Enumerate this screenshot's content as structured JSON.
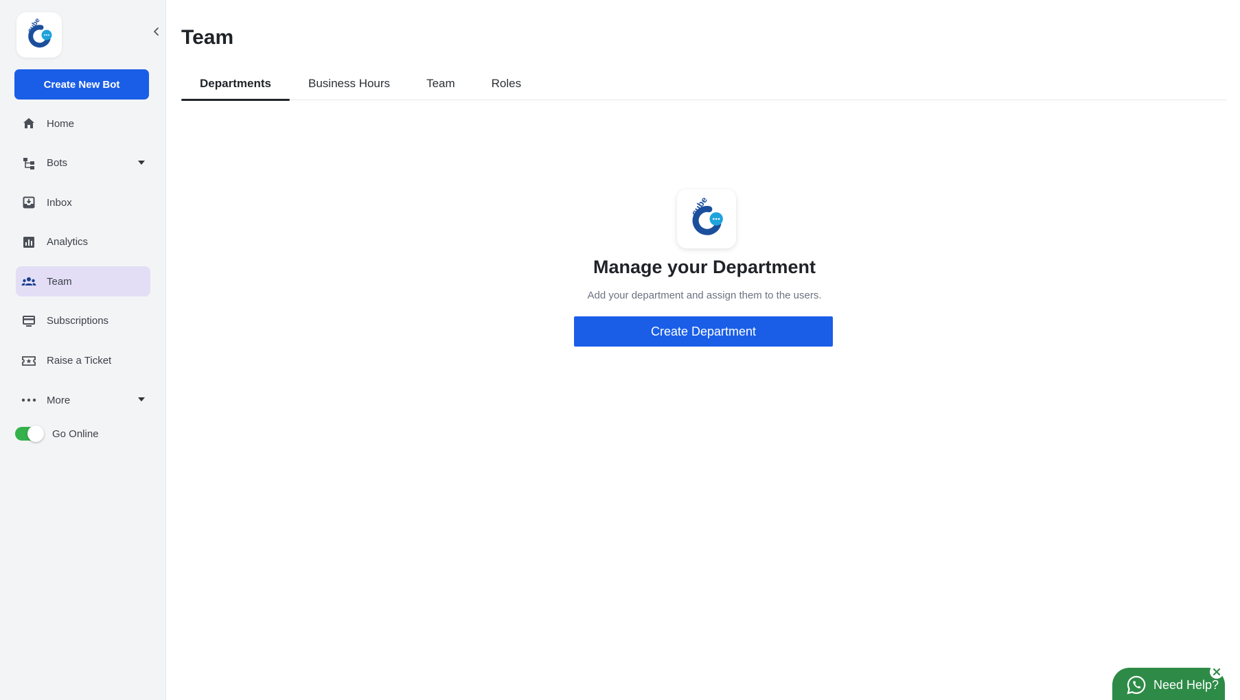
{
  "sidebar": {
    "create_button": "Create New Bot",
    "items": [
      {
        "label": "Home",
        "icon": "home-icon"
      },
      {
        "label": "Bots",
        "icon": "bots-icon",
        "has_caret": true
      },
      {
        "label": "Inbox",
        "icon": "inbox-icon"
      },
      {
        "label": "Analytics",
        "icon": "analytics-icon"
      },
      {
        "label": "Team",
        "icon": "team-icon",
        "active": true
      },
      {
        "label": "Subscriptions",
        "icon": "subscriptions-icon"
      },
      {
        "label": "Raise a Ticket",
        "icon": "ticket-icon"
      },
      {
        "label": "More",
        "icon": "more-icon",
        "has_caret": true
      }
    ],
    "online_label": "Go Online",
    "online_state": true
  },
  "header": {
    "title": "Team"
  },
  "tabs": [
    {
      "label": "Departments",
      "active": true
    },
    {
      "label": "Business Hours"
    },
    {
      "label": "Team"
    },
    {
      "label": "Roles"
    }
  ],
  "empty_state": {
    "title": "Manage your Department",
    "subtitle": "Add your department and assign them to the users.",
    "button": "Create Department"
  },
  "help": {
    "label": "Need Help?"
  },
  "colors": {
    "primary": "#1a5ee8",
    "active_nav": "#e3def6",
    "toggle_on": "#34b14a",
    "help_bg": "#2e8b47",
    "brand_dark": "#1b4f9c",
    "brand_light": "#1fa3dc"
  }
}
